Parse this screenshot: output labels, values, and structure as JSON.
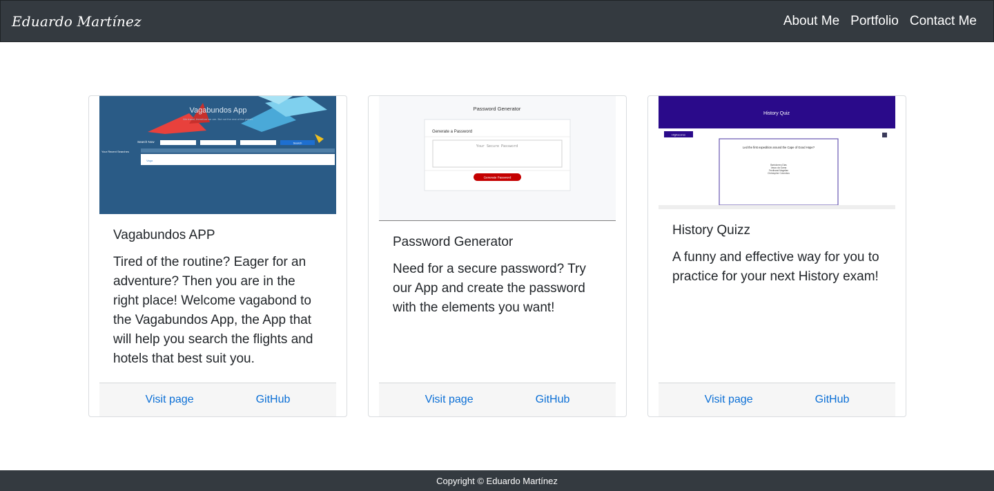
{
  "header": {
    "brand": "Eduardo Martínez",
    "nav": [
      "About Me",
      "Portfolio",
      "Contact Me"
    ]
  },
  "cards": [
    {
      "title": "Vagabundos APP",
      "text": "Tired of the routine? Eager for an adventure? Then you are in the right place! Welcome vagabond to the Vagabundos App, the App that will help you search the flights and hotels that best suit you.",
      "links": [
        "Visit page",
        "GitHub"
      ],
      "thumb": {
        "title": "Vagabundos App",
        "subtitle": "We travel, therefore we are. But not the rest of the planet.",
        "search_label": "Search Now",
        "recent_label": "Your Recent Searches",
        "search_button": "Search",
        "row_label": "Vaga"
      }
    },
    {
      "title": "Password Generator",
      "text": "Need for a secure password? Try our App and create the password with the elements you want!",
      "links": [
        "Visit page",
        "GitHub"
      ],
      "thumb": {
        "title": "Password Generator",
        "box_title": "Generate a Password",
        "placeholder": "Your Secure Password",
        "button": "Generate Password"
      }
    },
    {
      "title": "History Quizz",
      "text": "A funny and effective way for you to practice for your next History exam!",
      "links": [
        "Visit page",
        "GitHub"
      ],
      "thumb": {
        "title": "History Quiz",
        "highscores": "Highscores",
        "question": "Led the first expedition around the Cape of Good Hope?",
        "answers": [
          "Bartolomeu Dias",
          "Vasco da Gama",
          "Ferdinand Magellan",
          "Christopher Columbus"
        ]
      }
    }
  ],
  "footer": {
    "text": "Copyright © Eduardo Martínez"
  },
  "colors": {
    "navbar": "#343a40",
    "link": "#0b6fd6",
    "footer_bg": "#f6f6f6",
    "vaga_bg": "#2a5b86",
    "quiz_header": "#2a0a8a",
    "pw_button": "#c40000"
  }
}
